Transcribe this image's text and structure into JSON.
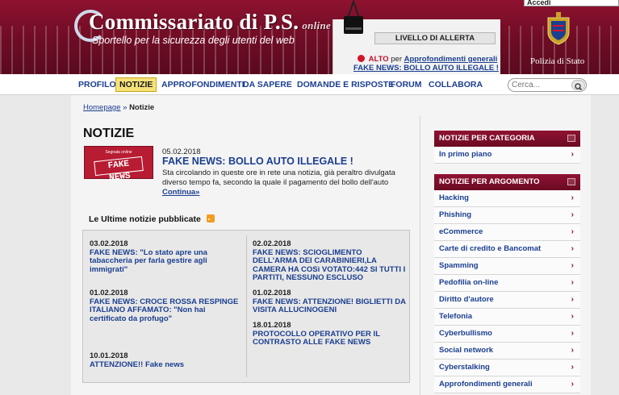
{
  "header": {
    "logo_title": "Commissariato di P.S.",
    "logo_suffix": "online",
    "logo_subtitle": "Sportello per la sicurezza degli utenti del web",
    "accedi_label": "Accedi",
    "alert_level_label": "LIVELLO DI ALLERTA",
    "alert_status": "ALTO",
    "alert_for": "per",
    "alert_link": "Approfondimenti generali",
    "alert_news": "FAKE NEWS: BOLLO AUTO ILLEGALE !",
    "emblem_label": "Polizia di Stato"
  },
  "nav": {
    "items": [
      "PROFILO",
      "NOTIZIE",
      "APPROFONDIMENTI",
      "DA SAPERE",
      "DOMANDE E RISPOSTE",
      "FORUM",
      "COLLABORA"
    ],
    "search_placeholder": "Cerca..."
  },
  "breadcrumb": {
    "home": "Homepage",
    "separator": "»",
    "current": "Notizie"
  },
  "main": {
    "title": "NOTIZIE",
    "featured": {
      "image_small_text": "Segnala online",
      "image_big_text": "FAKE NEWS",
      "date": "05.02.2018",
      "title": "FAKE NEWS: BOLLO AUTO ILLEGALE !",
      "text": "Sta circolando in queste ore in rete una notizia, già peraltro divulgata diverso tempo fa, secondo la quale il pagamento del bollo dell'auto",
      "more": "Continua»"
    },
    "latest_heading": "Le Ultime notizie pubblicate",
    "news": [
      {
        "date": "03.02.2018",
        "title": "FAKE NEWS: \"Lo stato apre una tabaccheria per farla gestire agli immigrati\""
      },
      {
        "date": "02.02.2018",
        "title": "FAKE NEWS: SCIOGLIMENTO DELL'ARMA DEI CARABINIERI,LA CAMERA HA COSì VOTATO:442 SI TUTTI I PARTITI, NESSUNO ESCLUSO"
      },
      {
        "date": "01.02.2018",
        "title": "FAKE NEWS: CROCE ROSSA RESPINGE ITALIANO AFFAMATO: \"Non hai certificato da profugo\""
      },
      {
        "date": "01.02.2018",
        "title": "FAKE NEWS: ATTENZIONE! BIGLIETTI DA VISITA ALLUCINOGENI"
      },
      {
        "date": "18.01.2018",
        "title": "PROTOCOLLO OPERATIVO PER IL CONTRASTO ALLE FAKE NEWS"
      },
      {
        "date": "10.01.2018",
        "title": "ATTENZIONE!! Fake news"
      }
    ]
  },
  "sidebar": {
    "category_header": "NOTIZIE PER CATEGORIA",
    "category_items": [
      "In primo piano"
    ],
    "topic_header": "NOTIZIE PER ARGOMENTO",
    "topic_items": [
      "Hacking",
      "Phishing",
      "eCommerce",
      "Carte di credito e Bancomat",
      "Spamming",
      "Pedofilia on-line",
      "Diritto d'autore",
      "Telefonia",
      "Cyberbullismo",
      "Social network",
      "Cyberstalking",
      "Approfondimenti generali"
    ],
    "arrow_glyph": "›"
  },
  "colors": {
    "header_bg": "#7a0f2a",
    "link": "#1a3e8f",
    "active_nav": "#f6e27a",
    "alert_red": "#d4142b"
  }
}
